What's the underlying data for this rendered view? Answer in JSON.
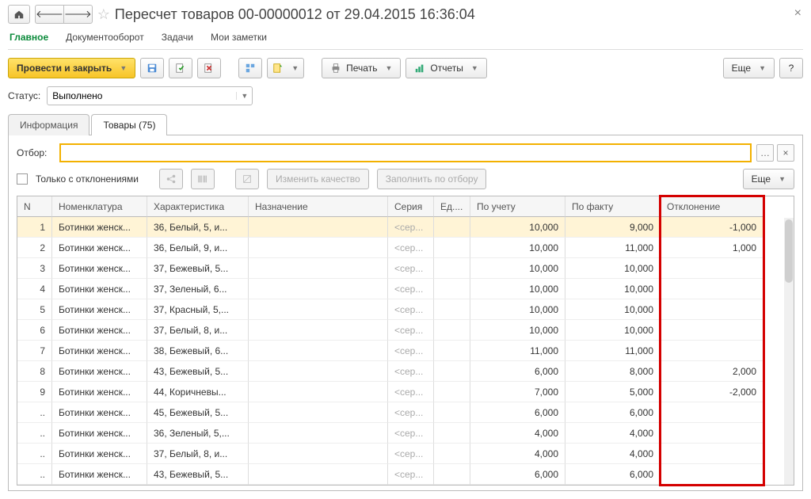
{
  "title": "Пересчет товаров 00-00000012 от 29.04.2015 16:36:04",
  "topTabs": {
    "main": "Главное",
    "workflow": "Документооборот",
    "tasks": "Задачи",
    "notes": "Мои заметки"
  },
  "toolbar": {
    "postAndClose": "Провести и закрыть",
    "print": "Печать",
    "reports": "Отчеты",
    "more": "Еще"
  },
  "status": {
    "label": "Статус:",
    "value": "Выполнено"
  },
  "sheetTabs": {
    "info": "Информация",
    "goods": "Товары (75)"
  },
  "filter": {
    "label": "Отбор:"
  },
  "row2": {
    "onlyDeviations": "Только с отклонениями",
    "changeQuality": "Изменить качество",
    "fillByFilter": "Заполнить по отбору",
    "more": "Еще"
  },
  "columns": {
    "n": "N",
    "nomen": "Номенклатура",
    "char": "Характеристика",
    "assign": "Назначение",
    "series": "Серия",
    "unit": "Ед....",
    "byAccount": "По учету",
    "byFact": "По факту",
    "dev": "Отклонение"
  },
  "seriesPlaceholder": "<сер...",
  "rows": [
    {
      "n": "1",
      "nomen": "Ботинки женск...",
      "char": "36, Белый, 5, и...",
      "acc": "10,000",
      "fact": "9,000",
      "dev": "-1,000"
    },
    {
      "n": "2",
      "nomen": "Ботинки женск...",
      "char": "36, Белый, 9, и...",
      "acc": "10,000",
      "fact": "11,000",
      "dev": "1,000"
    },
    {
      "n": "3",
      "nomen": "Ботинки женск...",
      "char": "37, Бежевый, 5...",
      "acc": "10,000",
      "fact": "10,000",
      "dev": ""
    },
    {
      "n": "4",
      "nomen": "Ботинки женск...",
      "char": "37, Зеленый, 6...",
      "acc": "10,000",
      "fact": "10,000",
      "dev": ""
    },
    {
      "n": "5",
      "nomen": "Ботинки женск...",
      "char": "37, Красный, 5,...",
      "acc": "10,000",
      "fact": "10,000",
      "dev": ""
    },
    {
      "n": "6",
      "nomen": "Ботинки женск...",
      "char": "37, Белый, 8, и...",
      "acc": "10,000",
      "fact": "10,000",
      "dev": ""
    },
    {
      "n": "7",
      "nomen": "Ботинки женск...",
      "char": "38, Бежевый, 6...",
      "acc": "11,000",
      "fact": "11,000",
      "dev": ""
    },
    {
      "n": "8",
      "nomen": "Ботинки женск...",
      "char": "43, Бежевый, 5...",
      "acc": "6,000",
      "fact": "8,000",
      "dev": "2,000"
    },
    {
      "n": "9",
      "nomen": "Ботинки женск...",
      "char": "44, Коричневы...",
      "acc": "7,000",
      "fact": "5,000",
      "dev": "-2,000"
    },
    {
      "n": "..",
      "nomen": "Ботинки женск...",
      "char": "45, Бежевый, 5...",
      "acc": "6,000",
      "fact": "6,000",
      "dev": ""
    },
    {
      "n": "..",
      "nomen": "Ботинки женск...",
      "char": "36, Зеленый, 5,...",
      "acc": "4,000",
      "fact": "4,000",
      "dev": ""
    },
    {
      "n": "..",
      "nomen": "Ботинки женск...",
      "char": "37, Белый, 8, и...",
      "acc": "4,000",
      "fact": "4,000",
      "dev": ""
    },
    {
      "n": "..",
      "nomen": "Ботинки женск...",
      "char": "43, Бежевый, 5...",
      "acc": "6,000",
      "fact": "6,000",
      "dev": ""
    }
  ]
}
